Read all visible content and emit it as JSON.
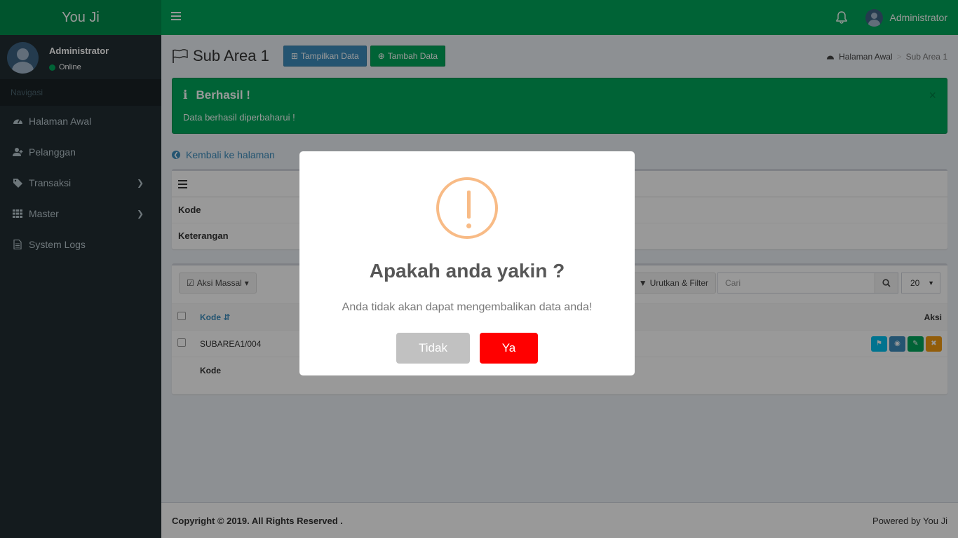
{
  "app": {
    "logo": "You Ji"
  },
  "header": {
    "user_name": "Administrator"
  },
  "sidebar": {
    "user_name": "Administrator",
    "status": "Online",
    "nav_header": "Navigasi",
    "items": [
      {
        "label": "Halaman Awal",
        "icon": "dashboard-icon"
      },
      {
        "label": "Pelanggan",
        "icon": "user-plus-icon"
      },
      {
        "label": "Transaksi",
        "icon": "tags-icon"
      },
      {
        "label": "Master",
        "icon": "grid-icon"
      },
      {
        "label": "System Logs",
        "icon": "file-icon"
      }
    ]
  },
  "page": {
    "title": "Sub Area 1",
    "btn_show": "Tampilkan Data",
    "btn_add": "Tambah Data",
    "breadcrumb": {
      "home": "Halaman Awal",
      "current": "Sub Area 1"
    }
  },
  "alert": {
    "title": "Berhasil !",
    "message": "Data berhasil diperbaharui !",
    "close": "×"
  },
  "back_link": "Kembali ke halaman",
  "detail": {
    "rows": [
      "Kode",
      "Keterangan"
    ]
  },
  "list": {
    "bulk_action": "Aksi Massal",
    "sort_filter": "Urutkan & Filter",
    "search_placeholder": "Cari",
    "per_page": "20",
    "headers": {
      "kode": "Kode",
      "aksi": "Aksi"
    },
    "rows": [
      {
        "kode": "SUBAREA1/004"
      }
    ],
    "subrow": {
      "label": "Kode",
      "value": "-"
    }
  },
  "footer": {
    "copyright": "Copyright © 2019. All Rights Reserved .",
    "powered": "Powered by You Ji"
  },
  "modal": {
    "title": "Apakah anda yakin ?",
    "text": "Anda tidak akan dapat mengembalikan data anda!",
    "cancel": "Tidak",
    "confirm": "Ya"
  },
  "colors": {
    "header": "#00a65a",
    "logo": "#008d4c",
    "sidebar": "#222d32",
    "primary": "#3c8dbc",
    "warning_icon": "#f8bb86",
    "confirm": "#ff0000",
    "cancel": "#c1c1c1"
  }
}
